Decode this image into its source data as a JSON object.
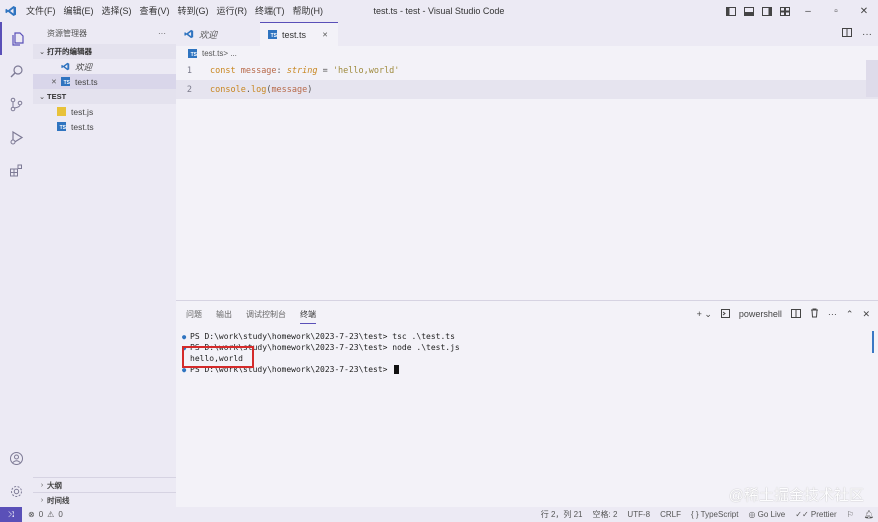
{
  "window": {
    "title": "test.ts - test - Visual Studio Code"
  },
  "menu": [
    "文件(F)",
    "编辑(E)",
    "选择(S)",
    "查看(V)",
    "转到(G)",
    "运行(R)",
    "终端(T)",
    "帮助(H)"
  ],
  "sidebar": {
    "title": "资源管理器",
    "more": "···",
    "open_editors": {
      "title": "打开的编辑器",
      "items": [
        {
          "label": "欢迎"
        },
        {
          "label": "test.ts",
          "close": "✕"
        }
      ]
    },
    "folder": {
      "title": "TEST",
      "items": [
        {
          "label": "test.js"
        },
        {
          "label": "test.ts"
        }
      ]
    },
    "bottom": [
      {
        "label": "大纲"
      },
      {
        "label": "时间线"
      }
    ]
  },
  "tabs": [
    {
      "label": "欢迎"
    },
    {
      "label": "test.ts",
      "close": "✕"
    }
  ],
  "breadcrumb": {
    "file": "test.ts",
    "rest": " > ..."
  },
  "code": [
    {
      "num": "1",
      "tokens": {
        "kw": "const",
        "var": "message",
        "colon": ":",
        "type": "string",
        "eq": "=",
        "str": "'hello,world'"
      }
    },
    {
      "num": "2",
      "tokens": {
        "obj": "console",
        "dot": ".",
        "fn": "log",
        "open": "(",
        "arg": "message",
        "close": ")"
      }
    }
  ],
  "panel": {
    "tabs": [
      "问题",
      "输出",
      "调试控制台",
      "终端"
    ],
    "actions": {
      "add": "+ ⌄",
      "shell": "powershell"
    },
    "terminal": [
      "PS D:\\work\\study\\homework\\2023-7-23\\test> tsc .\\test.ts",
      "PS D:\\work\\study\\homework\\2023-7-23\\test> node .\\test.js",
      "hello,world",
      "PS D:\\work\\study\\homework\\2023-7-23\\test> "
    ]
  },
  "status": {
    "errors": "0",
    "warnings": "0",
    "position": "行 2，列 21",
    "spaces": "空格: 2",
    "encoding": "UTF-8",
    "eol": "CRLF",
    "language": "TypeScript",
    "live": "Go Live",
    "prettier": "Prettier"
  },
  "watermark": "@稀土掘金技术社区",
  "colors": {
    "accent": "#5a50b8",
    "ts_icon": "#2f74c0",
    "js_icon": "#e8c23a",
    "highlight": "#d42a2a"
  }
}
